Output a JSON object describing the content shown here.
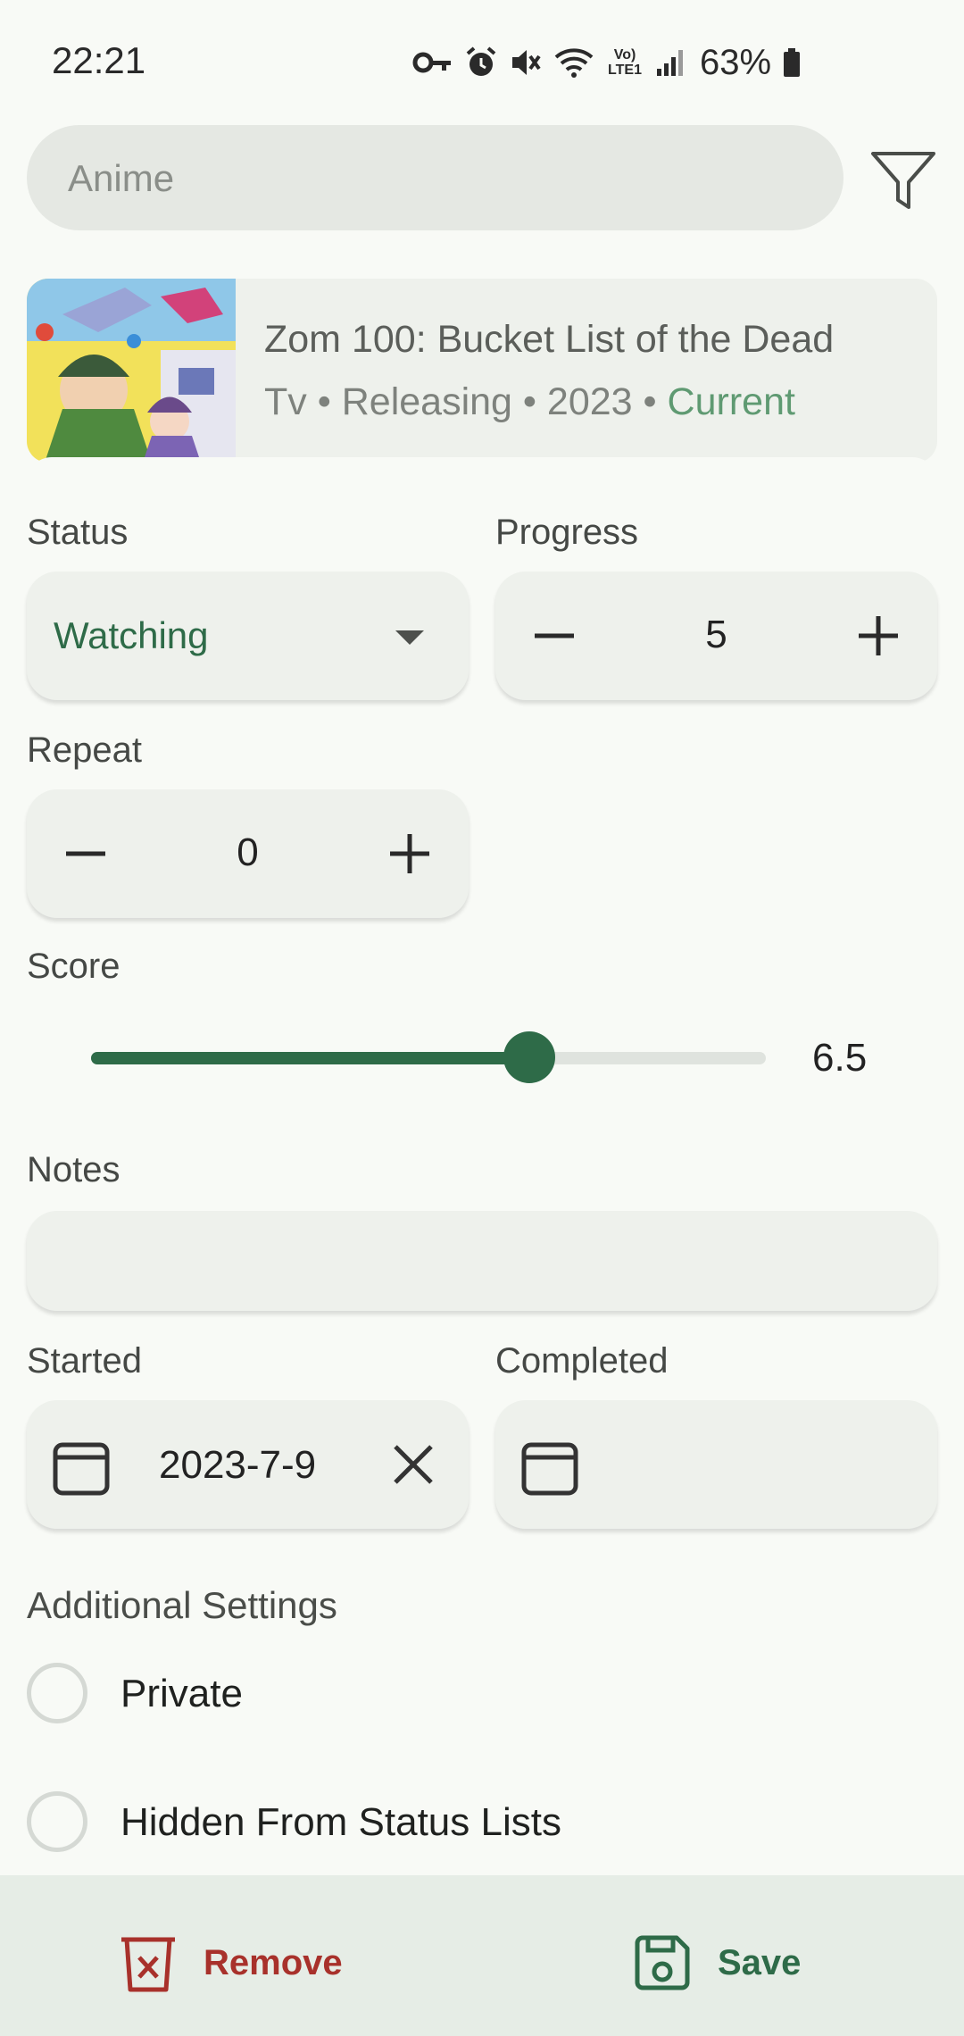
{
  "status_bar": {
    "time": "22:21",
    "battery": "63%",
    "icons": [
      "vpn-key-icon",
      "alarm-icon",
      "mute-icon",
      "wifi-icon",
      "volte-icon",
      "signal-icon",
      "battery-icon"
    ],
    "volte_text": "Vo) LTE1"
  },
  "search": {
    "placeholder": "Anime",
    "value": ""
  },
  "media": {
    "title": "Zom 100: Bucket List of the Dead",
    "format": "Tv",
    "status": "Releasing",
    "year": "2023",
    "season": "Current",
    "separator": " • "
  },
  "form": {
    "status_label": "Status",
    "status_value": "Watching",
    "progress_label": "Progress",
    "progress_value": "5",
    "repeat_label": "Repeat",
    "repeat_value": "0",
    "score_label": "Score",
    "score_value": "6.5",
    "score_numeric": 6.5,
    "score_max": 10,
    "notes_label": "Notes",
    "notes_value": "",
    "started_label": "Started",
    "started_value": "2023-7-9",
    "completed_label": "Completed",
    "completed_value": "",
    "additional_label": "Additional Settings",
    "private_label": "Private",
    "hidden_label": "Hidden From Status Lists"
  },
  "actions": {
    "remove_label": "Remove",
    "save_label": "Save"
  },
  "colors": {
    "accent": "#2e6b48",
    "danger": "#a8312b",
    "season_tint": "#5f9a72",
    "field_bg": "#eef1ec",
    "bottom_bar_bg": "#e6ede6"
  }
}
